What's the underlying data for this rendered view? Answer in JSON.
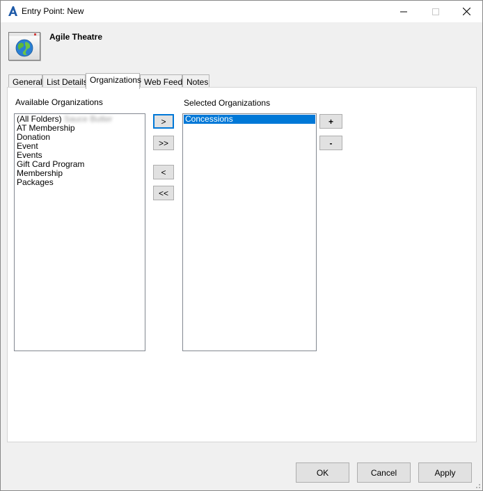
{
  "window": {
    "title": "Entry Point: New",
    "controls": [
      "minimize",
      "maximize",
      "close"
    ]
  },
  "header": {
    "entity_name": "Agile Theatre",
    "icon": "globe-icon"
  },
  "tabs": [
    {
      "label": "General",
      "active": false
    },
    {
      "label": "List Details",
      "active": false
    },
    {
      "label": "Organizations",
      "active": true
    },
    {
      "label": "Web Feed",
      "active": false
    },
    {
      "label": "Notes",
      "active": false
    }
  ],
  "organizations": {
    "available_label": "Available Organizations",
    "selected_label": "Selected Organizations",
    "available_items": [
      {
        "label": "(All Folders)",
        "suffix_obscured": "Sauce Butter"
      },
      {
        "label": "AT Membership"
      },
      {
        "label": "Donation"
      },
      {
        "label": "Event"
      },
      {
        "label": "Events"
      },
      {
        "label": "Gift Card Program"
      },
      {
        "label": "Membership"
      },
      {
        "label": "Packages"
      }
    ],
    "selected_items": [
      {
        "label": "Concessions",
        "selected": true
      }
    ],
    "move_buttons": {
      "add_one": ">",
      "add_all": ">>",
      "remove_one": "<",
      "remove_all": "<<"
    },
    "order_buttons": {
      "plus": "+",
      "minus": "-"
    }
  },
  "footer": {
    "ok": "OK",
    "cancel": "Cancel",
    "apply": "Apply"
  },
  "colors": {
    "selection": "#0078d7",
    "accent": "#1e5aa8"
  }
}
